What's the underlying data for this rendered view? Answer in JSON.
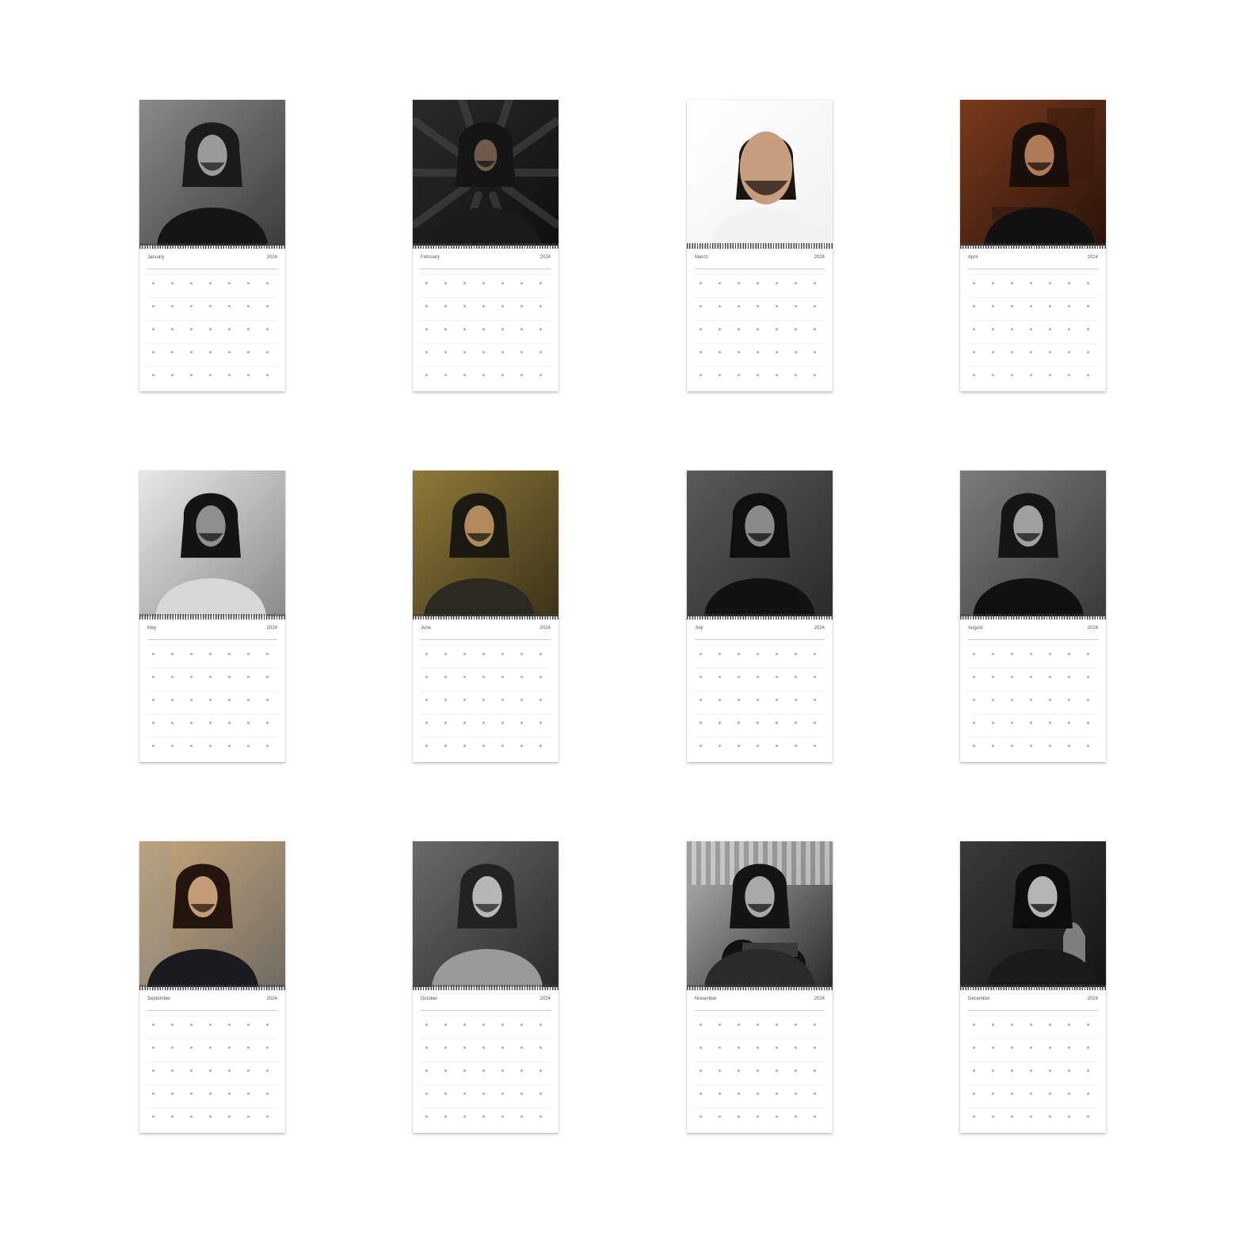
{
  "calendar": {
    "year": "2024",
    "months": [
      {
        "name": "January",
        "photo": "bw-portrait-leather-jacket"
      },
      {
        "name": "February",
        "photo": "dark-color-crowd-of-hands"
      },
      {
        "name": "March",
        "photo": "color-closeup-white-background"
      },
      {
        "name": "April",
        "photo": "warm-interior-seated-at-table"
      },
      {
        "name": "May",
        "photo": "bw-crouching-tshirt-outdoors"
      },
      {
        "name": "June",
        "photo": "amber-color-side-profile"
      },
      {
        "name": "July",
        "photo": "bw-sunglasses-portrait"
      },
      {
        "name": "August",
        "photo": "bw-dark-suit-portrait"
      },
      {
        "name": "September",
        "photo": "color-smiling-outdoors"
      },
      {
        "name": "October",
        "photo": "bw-seated-suit"
      },
      {
        "name": "November",
        "photo": "bw-motorcycle"
      },
      {
        "name": "December",
        "photo": "bw-hands-clasped"
      }
    ]
  }
}
